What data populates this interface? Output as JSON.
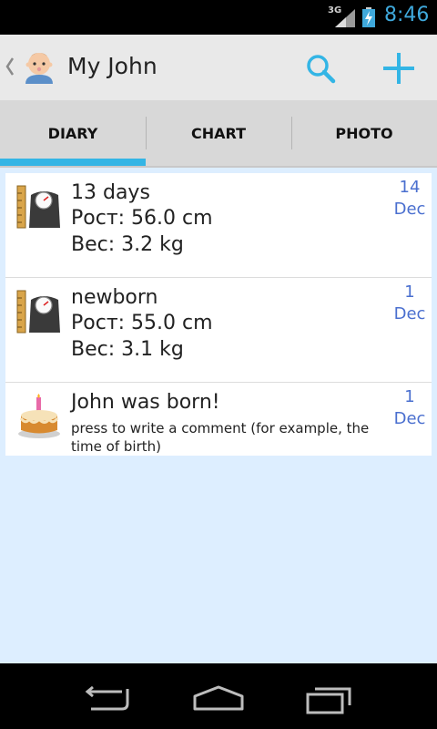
{
  "status_bar": {
    "network": "3G",
    "time": "8:46"
  },
  "action_bar": {
    "title": "My John",
    "icons": {
      "avatar": "baby-avatar-icon",
      "search": "search-icon",
      "add": "add-icon"
    }
  },
  "tabs": [
    {
      "label": "DIARY",
      "active": true
    },
    {
      "label": "CHART",
      "active": false
    },
    {
      "label": "PHOTO",
      "active": false
    }
  ],
  "entries": [
    {
      "title": "13 days",
      "line1": "Рост: 56.0 cm",
      "line2": "Вес: 3.2 kg",
      "day": "14",
      "month": "Dec",
      "icon": "scale-icon"
    },
    {
      "title": "newborn",
      "line1": "Рост: 55.0 cm",
      "line2": "Вес: 3.1 kg",
      "day": "1",
      "month": "Dec",
      "icon": "scale-icon"
    },
    {
      "title": "John was born!",
      "comment": "press to write a comment (for example, the time of birth)",
      "day": "1",
      "month": "Dec",
      "icon": "birthday-cake-icon"
    }
  ],
  "colors": {
    "accent": "#33b5e5",
    "date": "#4a6fcf",
    "background": "#ddeeff"
  }
}
